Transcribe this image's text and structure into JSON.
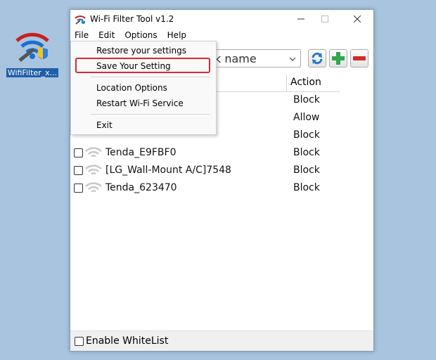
{
  "desktop": {
    "icon_label": "WifiFilter_x..."
  },
  "window": {
    "title": "Wi-Fi Filter Tool v1.2",
    "controls": {
      "minimize": "—",
      "maximize": "☐",
      "close": "✕"
    }
  },
  "menubar": {
    "items": [
      "File",
      "Edit",
      "Options",
      "Help"
    ]
  },
  "toolbar": {
    "network_combo_text": "k name"
  },
  "list": {
    "action_header": "Action",
    "rows": [
      {
        "ssid": "",
        "action": "Block"
      },
      {
        "ssid": "",
        "action": "Allow"
      },
      {
        "ssid": "",
        "action": "Block"
      },
      {
        "ssid": "Tenda_E9FBF0",
        "action": "Block"
      },
      {
        "ssid": "[LG_Wall-Mount A/C]7548",
        "action": "Block"
      },
      {
        "ssid": "Tenda_623470",
        "action": "Block"
      }
    ]
  },
  "footer": {
    "whitelist_label": "Enable WhiteList"
  },
  "file_menu": {
    "items": [
      "Restore your settings",
      "Save Your Setting",
      "Location Options",
      "Restart Wi-Fi Service",
      "Exit"
    ]
  },
  "colors": {
    "accent_red": "#d9272e",
    "add_green": "#2fa84f",
    "remove_red": "#d42a2a",
    "refresh_blue": "#2a76c9"
  }
}
